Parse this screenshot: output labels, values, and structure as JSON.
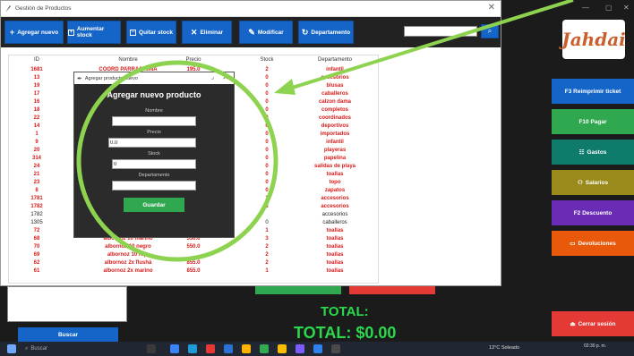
{
  "window": {
    "title": "Gestión de Productos"
  },
  "toolbar": {
    "add_label": "Agregar nuevo",
    "increase_stock_label": "Aumentar stock",
    "remove_stock_label": "Quitar stock",
    "delete_label": "Eliminar",
    "modify_label": "Modificar",
    "department_label": "Departamento",
    "search_value": ""
  },
  "table": {
    "headers": {
      "id": "ID",
      "name": "Nombre",
      "price": "Precio",
      "stock": "Stock",
      "department": "Departamento"
    },
    "rows": [
      {
        "id": "1681",
        "name": "COORD PARRAS NIÑA",
        "price": "195.0",
        "stock": "2",
        "department": "infantil"
      },
      {
        "id": "13",
        "name": "",
        "price": "",
        "stock": "0",
        "department": "accesorios"
      },
      {
        "id": "19",
        "name": "",
        "price": "",
        "stock": "0",
        "department": "blusas"
      },
      {
        "id": "17",
        "name": "",
        "price": "",
        "stock": "0",
        "department": "caballeros"
      },
      {
        "id": "16",
        "name": "",
        "price": "",
        "stock": "0",
        "department": "calzon dama"
      },
      {
        "id": "18",
        "name": "",
        "price": "",
        "stock": "0",
        "department": "completos"
      },
      {
        "id": "22",
        "name": "",
        "price": "",
        "stock": "2",
        "department": "coordinados"
      },
      {
        "id": "14",
        "name": "",
        "price": "",
        "stock": "0",
        "department": "deportivos"
      },
      {
        "id": "1",
        "name": "",
        "price": "",
        "stock": "0",
        "department": "importados"
      },
      {
        "id": "9",
        "name": "",
        "price": "",
        "stock": "0",
        "department": "infantil"
      },
      {
        "id": "20",
        "name": "",
        "price": "",
        "stock": "0",
        "department": "playeras"
      },
      {
        "id": "314",
        "name": "",
        "price": "",
        "stock": "0",
        "department": "papelina"
      },
      {
        "id": "24",
        "name": "",
        "price": "",
        "stock": "0",
        "department": "salidas de playa"
      },
      {
        "id": "21",
        "name": "",
        "price": "",
        "stock": "0",
        "department": "toallas"
      },
      {
        "id": "23",
        "name": "",
        "price": "",
        "stock": "0",
        "department": "topo"
      },
      {
        "id": "8",
        "name": "",
        "price": "",
        "stock": "0",
        "department": "zapatos"
      },
      {
        "id": "1781",
        "name": "",
        "price": "",
        "stock": "2",
        "department": "accesorios"
      },
      {
        "id": "1782",
        "name": "",
        "price": "",
        "stock": "3",
        "department": "accesorios"
      },
      {
        "id": "1782",
        "name": "",
        "price": "",
        "stock": "",
        "department": "accesorios",
        "style": "black"
      },
      {
        "id": "1305",
        "name": "",
        "price": "",
        "stock": "0",
        "department": "caballeros",
        "style": "black"
      },
      {
        "id": "72",
        "name": "",
        "price": "",
        "stock": "1",
        "department": "toallas"
      },
      {
        "id": "68",
        "name": "albornoz 10 marino",
        "price": "550.0",
        "stock": "3",
        "department": "toallas"
      },
      {
        "id": "70",
        "name": "albornoz 10 negro",
        "price": "550.0",
        "stock": "2",
        "department": "toallas"
      },
      {
        "id": "69",
        "name": "albornoz 10 rojo",
        "price": "",
        "stock": "2",
        "department": "toallas"
      },
      {
        "id": "62",
        "name": "albornoz 2x flushá",
        "price": "855.0",
        "stock": "2",
        "department": "toallas"
      },
      {
        "id": "61",
        "name": "albornoz 2x marino",
        "price": "855.0",
        "stock": "1",
        "department": "toallas"
      }
    ]
  },
  "bottom": {
    "search_button": "Buscar",
    "total_label": "TOTAL:",
    "total_value": "TOTAL: $0.00"
  },
  "sidebar": {
    "logo_text": "Jahdai",
    "reprint_label": "F3 Reimprimir ticket",
    "pay_label": "F10 Pagar",
    "expenses_label": "Gastos",
    "salaries_label": "Salarios",
    "discount_label": "F2 Descuento",
    "returns_label": "Devoluciones",
    "logout_label": "Cerrar sesión"
  },
  "dialog": {
    "window_title": "Agregar producto nuevo",
    "heading": "Agregar nuevo producto",
    "name_label": "Nombre",
    "name_value": "",
    "price_label": "Precio",
    "price_value": "0.0",
    "stock_label": "Stock",
    "stock_value": "0",
    "department_label": "Departamento",
    "department_value": "",
    "save_label": "Guardar"
  },
  "taskbar": {
    "search_placeholder": "Buscar",
    "weather": "13°C  Soleado",
    "time": "02:30 p. m."
  },
  "colors": {
    "accent_blue": "#1565c8",
    "pay_green": "#2fa84f",
    "expenses_teal": "#0f7c6b",
    "salaries_olive": "#9a8a1c",
    "discount_purple": "#6a2bb5",
    "returns_orange": "#e8590c",
    "logout_red": "#e53935",
    "total_green": "#2bd94c",
    "row_red": "#d81b1b",
    "annotation_green": "#8ed34f"
  }
}
